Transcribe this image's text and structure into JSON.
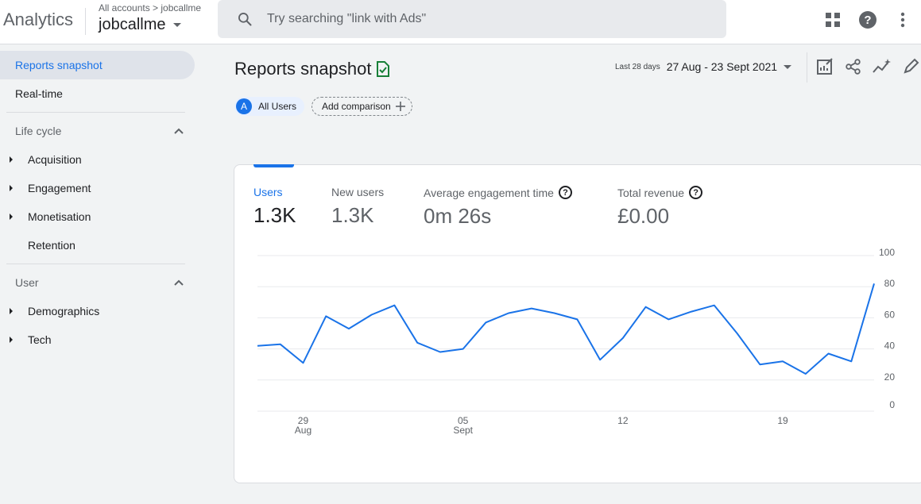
{
  "header": {
    "product": "Analytics",
    "breadcrumb": "All accounts > jobcallme",
    "account": "jobcallme",
    "search_placeholder": "Try searching \"link with Ads\""
  },
  "sidebar": {
    "items": [
      {
        "label": "Reports snapshot"
      },
      {
        "label": "Real-time"
      }
    ],
    "lifecycle": {
      "title": "Life cycle",
      "items": [
        "Acquisition",
        "Engagement",
        "Monetisation",
        "Retention"
      ]
    },
    "user": {
      "title": "User",
      "items": [
        "Demographics",
        "Tech"
      ]
    }
  },
  "main": {
    "title": "Reports snapshot",
    "date_label": "Last 28 days",
    "date_range": "27 Aug - 23 Sept 2021",
    "chips": {
      "badge": "A",
      "all_users": "All Users",
      "add_comparison": "Add comparison"
    },
    "metrics": [
      {
        "label": "Users",
        "value": "1.3K"
      },
      {
        "label": "New users",
        "value": "1.3K"
      },
      {
        "label": "Average engagement time",
        "value": "0m 26s"
      },
      {
        "label": "Total revenue",
        "value": "£0.00"
      }
    ]
  },
  "colors": {
    "accent": "#1a73e8",
    "line": "#1a73e8"
  },
  "chart_data": {
    "type": "line",
    "x": [
      "27 Aug",
      "28 Aug",
      "29 Aug",
      "30 Aug",
      "31 Aug",
      "01 Sept",
      "02 Sept",
      "03 Sept",
      "04 Sept",
      "05 Sept",
      "06 Sept",
      "07 Sept",
      "08 Sept",
      "09 Sept",
      "10 Sept",
      "11 Sept",
      "12 Sept",
      "13 Sept",
      "14 Sept",
      "15 Sept",
      "16 Sept",
      "17 Sept",
      "18 Sept",
      "19 Sept",
      "20 Sept",
      "21 Sept",
      "22 Sept",
      "23 Sept"
    ],
    "series": [
      {
        "values": [
          42,
          43,
          31,
          61,
          53,
          62,
          68,
          44,
          38,
          40,
          57,
          63,
          66,
          63,
          59,
          33,
          47,
          67,
          59,
          64,
          68,
          50,
          30,
          32,
          24,
          37,
          32,
          82
        ]
      }
    ],
    "x_tick_labels": [
      {
        "day": "29",
        "month": "Aug"
      },
      {
        "day": "05",
        "month": "Sept"
      },
      {
        "day": "12",
        "month": ""
      },
      {
        "day": "19",
        "month": ""
      }
    ],
    "y_ticks": [
      "100",
      "80",
      "60",
      "40",
      "20",
      "0"
    ],
    "ylim": [
      0,
      100
    ],
    "grid": true
  }
}
